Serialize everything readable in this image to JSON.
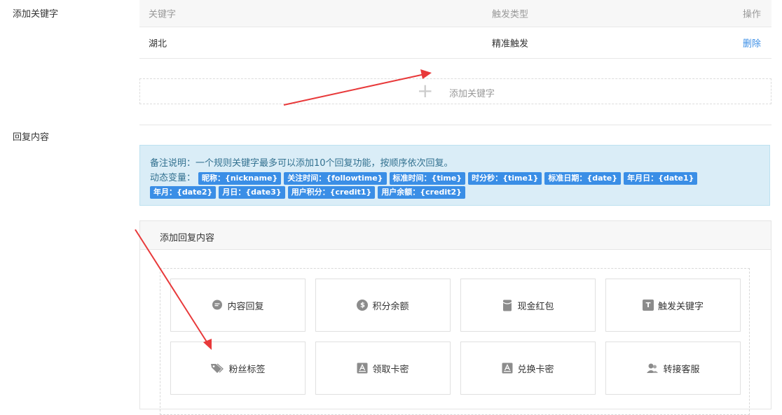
{
  "labels": {
    "add_keyword": "添加关键字",
    "reply_content": "回复内容"
  },
  "keyword_table": {
    "headers": [
      "关键字",
      "触发类型",
      "操作"
    ],
    "rows": [
      {
        "keyword": "湖北",
        "type": "精准触发",
        "action": "删除"
      }
    ],
    "add_button": "添加关键字"
  },
  "info": {
    "note": "备注说明：一个规则关键字最多可以添加10个回复功能，按顺序依次回复。",
    "vars_label": "动态变量：",
    "tags": [
      "昵称：{nickname}",
      "关注时间：{followtime}",
      "标准时间：{time}",
      "时分秒：{time1}",
      "标准日期：{date}",
      "年月日：{date1}",
      "年月：{date2}",
      "月日：{date3}",
      "用户积分：{credit1}",
      "用户余额：{credit2}"
    ]
  },
  "panel": {
    "title": "添加回复内容",
    "cards": [
      {
        "label": "内容回复",
        "icon": "chat-bubble-icon"
      },
      {
        "label": "积分余额",
        "icon": "dollar-coin-icon"
      },
      {
        "label": "现金红包",
        "icon": "red-packet-icon"
      },
      {
        "label": "触发关键字",
        "icon": "text-t-icon"
      },
      {
        "label": "粉丝标签",
        "icon": "tag-icon"
      },
      {
        "label": "领取卡密",
        "icon": "card-key-icon"
      },
      {
        "label": "兑换卡密",
        "icon": "card-exchange-icon"
      },
      {
        "label": "转接客服",
        "icon": "customer-service-icon"
      }
    ]
  },
  "colors": {
    "link": "#3a8ee6",
    "tag_bg": "#3a8ee6",
    "info_bg": "#daedf7",
    "arrow": "#e8393a"
  }
}
